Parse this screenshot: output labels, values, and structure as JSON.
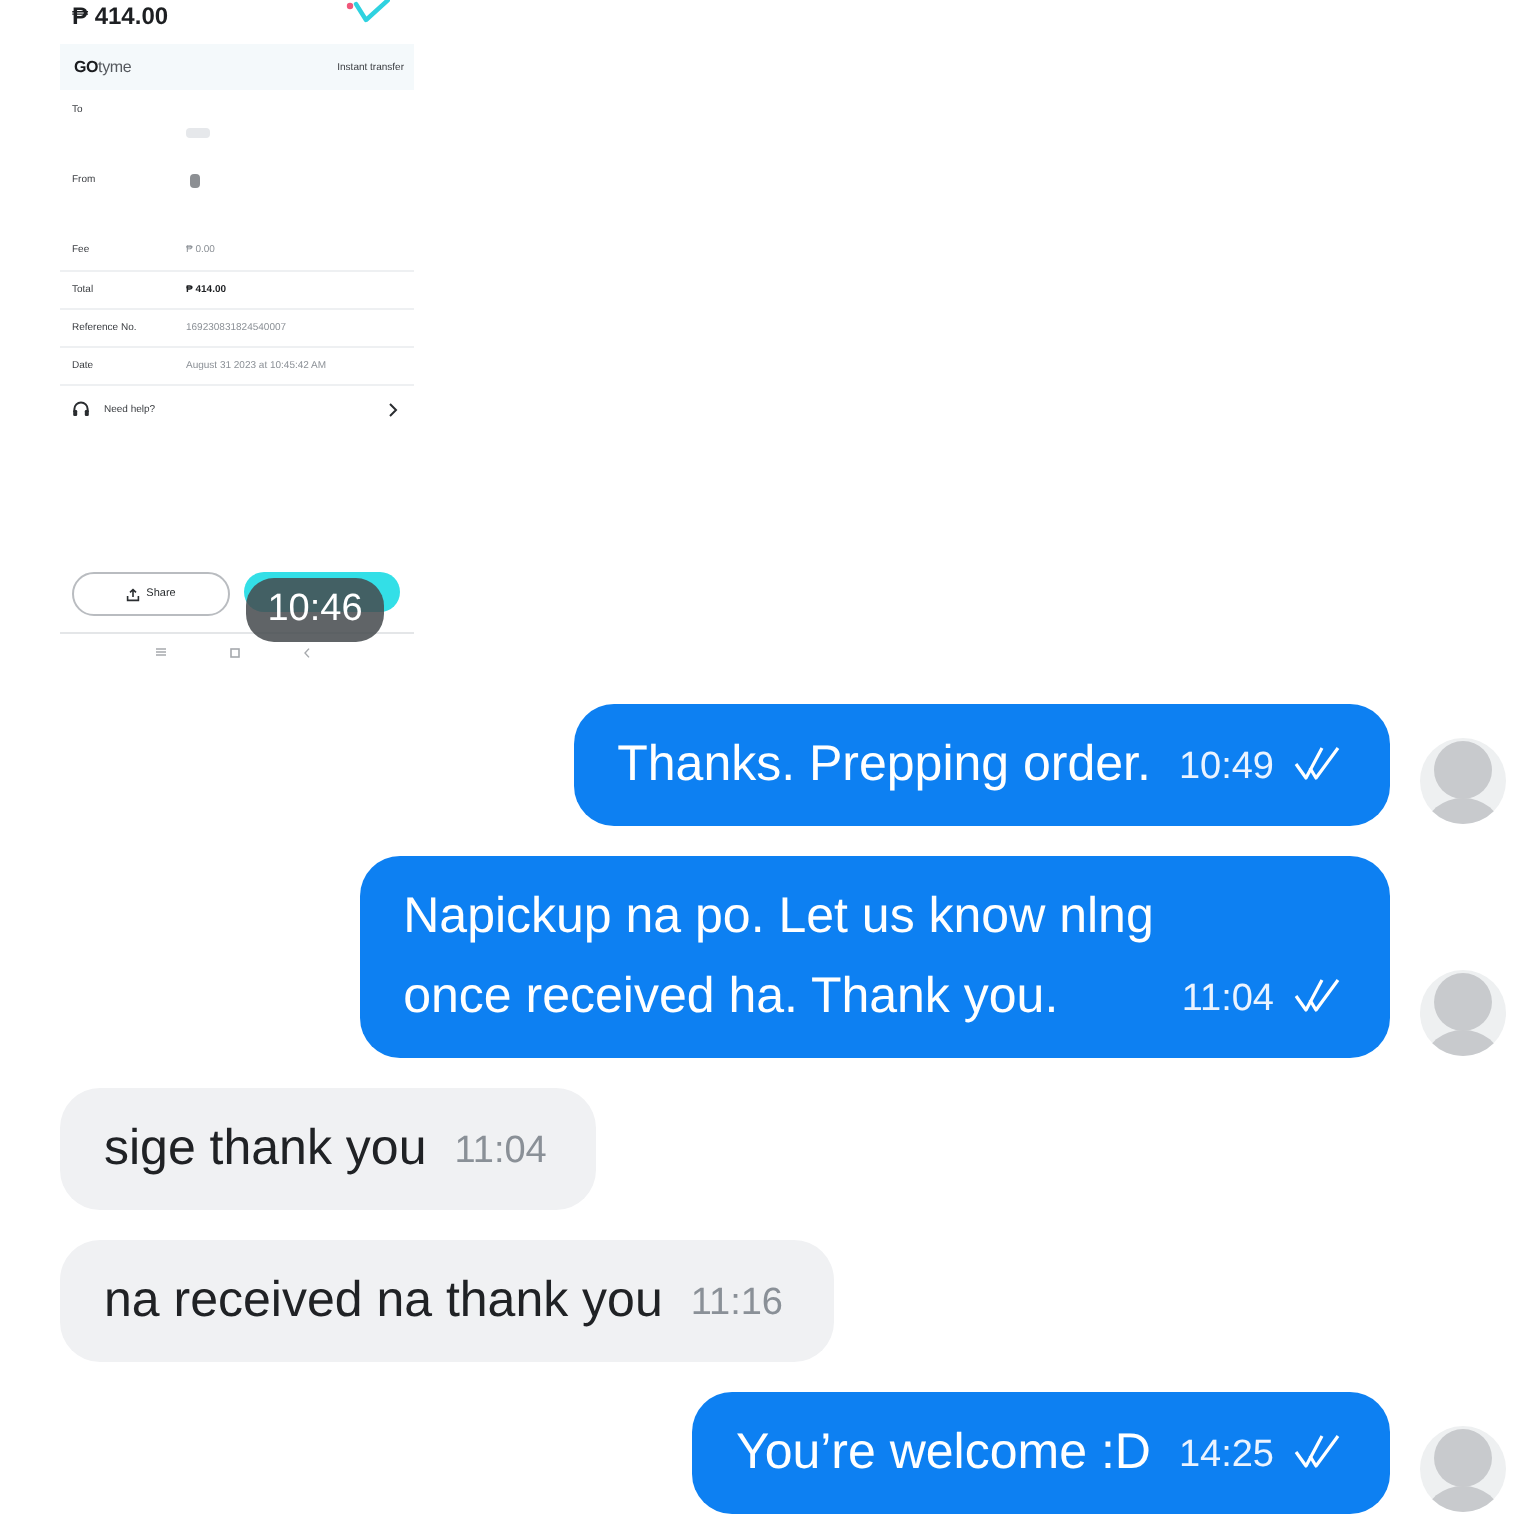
{
  "messages": [
    {
      "kind": "image",
      "time": "10:46",
      "receipt": {
        "amount": "₱ 414.00",
        "brand": "**GO**tyme",
        "transfer_type": "Instant transfer",
        "rows": [
          {
            "kind": "stacked",
            "label": "To"
          },
          {
            "kind": "inline",
            "label": "From"
          },
          {
            "kind": "value",
            "label": "Fee",
            "value": "₱ 0.00",
            "bold": false
          },
          {
            "kind": "value",
            "label": "Total",
            "value": "₱ 414.00",
            "bold": true
          },
          {
            "kind": "value",
            "label": "Reference No.",
            "value": "169230831824540007",
            "bold": false
          },
          {
            "kind": "value",
            "label": "Date",
            "value": "August 31 2023 at 10:45:42 AM",
            "bold": false
          }
        ],
        "help": "Need help?",
        "share": "Share"
      }
    },
    {
      "kind": "sent",
      "text": "Thanks. Prepping order.",
      "time": "10:49"
    },
    {
      "kind": "sent",
      "text": "Napickup na po. Let us know nlng\nonce received ha. Thank you.",
      "time": "11:04"
    },
    {
      "kind": "received",
      "text": "sige thank you",
      "time": "11:04"
    },
    {
      "kind": "received",
      "text": "na received na thank you",
      "time": "11:16"
    },
    {
      "kind": "sent",
      "text": "You’re welcome :D",
      "time": "14:25"
    }
  ]
}
